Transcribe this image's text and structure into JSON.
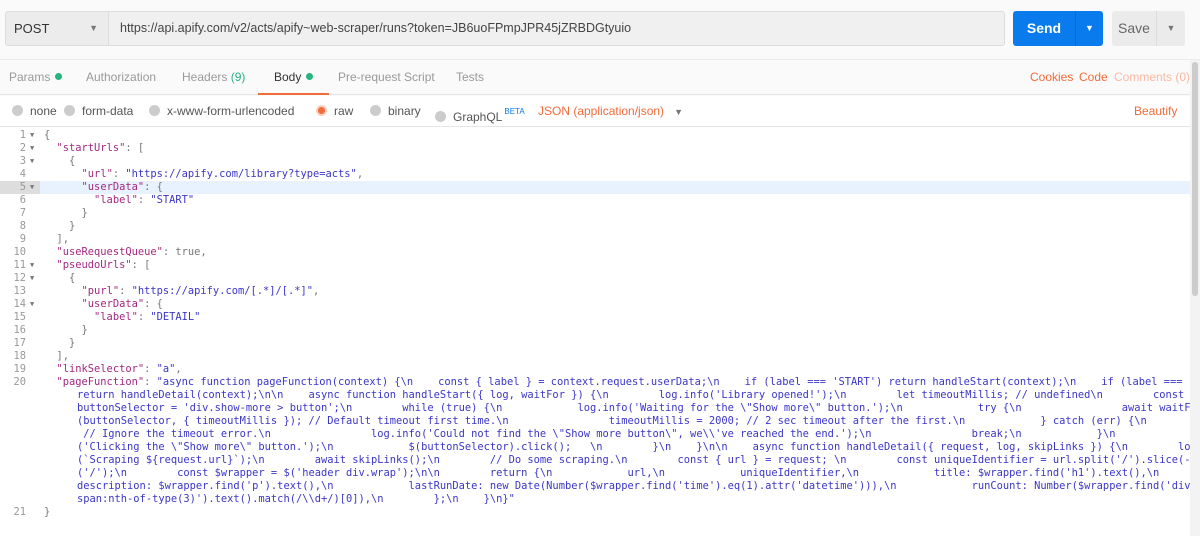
{
  "request": {
    "method": "POST",
    "url": "https://api.apify.com/v2/acts/apify~web-scraper/runs?token=JB6uoFPmpJPR45jZRBDGtyuio",
    "send_label": "Send",
    "save_label": "Save"
  },
  "tabs": [
    {
      "label": "Params",
      "dot": true
    },
    {
      "label": "Authorization"
    },
    {
      "label": "Headers",
      "count": "(9)"
    },
    {
      "label": "Body",
      "dot": true,
      "active": true
    },
    {
      "label": "Pre-request Script"
    },
    {
      "label": "Tests"
    }
  ],
  "links": {
    "cookies": "Cookies",
    "code": "Code",
    "comments": "Comments (0)"
  },
  "body_types": [
    {
      "label": "none"
    },
    {
      "label": "form-data"
    },
    {
      "label": "x-www-form-urlencoded"
    },
    {
      "label": "raw",
      "selected": true
    },
    {
      "label": "binary"
    },
    {
      "label": "GraphQL",
      "badge": "BETA"
    }
  ],
  "content_type": "JSON (application/json)",
  "beautify": "Beautify",
  "colors": {
    "accent": "#f26b3a",
    "send": "#097bed",
    "key": "#a3287f",
    "string": "#3b36c7"
  },
  "editor": {
    "lines": [
      {
        "n": "1",
        "fold": true,
        "parts": [
          [
            "p",
            "{"
          ]
        ]
      },
      {
        "n": "2",
        "fold": true,
        "parts": [
          [
            "p",
            "  "
          ],
          [
            "k",
            "\"startUrls\""
          ],
          [
            "p",
            ": ["
          ]
        ]
      },
      {
        "n": "3",
        "fold": true,
        "parts": [
          [
            "p",
            "    {"
          ]
        ]
      },
      {
        "n": "4",
        "parts": [
          [
            "p",
            "      "
          ],
          [
            "k",
            "\"url\""
          ],
          [
            "p",
            ": "
          ],
          [
            "s",
            "\"https://apify.com/library?type=acts\""
          ],
          [
            "p",
            ","
          ]
        ]
      },
      {
        "n": "5",
        "fold": true,
        "hl": true,
        "parts": [
          [
            "p",
            "      "
          ],
          [
            "k",
            "\"userData\""
          ],
          [
            "p",
            ": {"
          ]
        ]
      },
      {
        "n": "6",
        "parts": [
          [
            "p",
            "        "
          ],
          [
            "k",
            "\"label\""
          ],
          [
            "p",
            ": "
          ],
          [
            "s",
            "\"START\""
          ]
        ]
      },
      {
        "n": "7",
        "parts": [
          [
            "p",
            "      }"
          ]
        ]
      },
      {
        "n": "8",
        "parts": [
          [
            "p",
            "    }"
          ]
        ]
      },
      {
        "n": "9",
        "parts": [
          [
            "p",
            "  ],"
          ]
        ]
      },
      {
        "n": "10",
        "parts": [
          [
            "p",
            "  "
          ],
          [
            "k",
            "\"useRequestQueue\""
          ],
          [
            "p",
            ": true,"
          ]
        ]
      },
      {
        "n": "11",
        "fold": true,
        "parts": [
          [
            "p",
            "  "
          ],
          [
            "k",
            "\"pseudoUrls\""
          ],
          [
            "p",
            ": ["
          ]
        ]
      },
      {
        "n": "12",
        "fold": true,
        "parts": [
          [
            "p",
            "    {"
          ]
        ]
      },
      {
        "n": "13",
        "parts": [
          [
            "p",
            "      "
          ],
          [
            "k",
            "\"purl\""
          ],
          [
            "p",
            ": "
          ],
          [
            "s",
            "\"https://apify.com/[.*]/[.*]\""
          ],
          [
            "p",
            ","
          ]
        ]
      },
      {
        "n": "14",
        "fold": true,
        "parts": [
          [
            "p",
            "      "
          ],
          [
            "k",
            "\"userData\""
          ],
          [
            "p",
            ": {"
          ]
        ]
      },
      {
        "n": "15",
        "parts": [
          [
            "p",
            "        "
          ],
          [
            "k",
            "\"label\""
          ],
          [
            "p",
            ": "
          ],
          [
            "s",
            "\"DETAIL\""
          ]
        ]
      },
      {
        "n": "16",
        "parts": [
          [
            "p",
            "      }"
          ]
        ]
      },
      {
        "n": "17",
        "parts": [
          [
            "p",
            "    }"
          ]
        ]
      },
      {
        "n": "18",
        "parts": [
          [
            "p",
            "  ],"
          ]
        ]
      },
      {
        "n": "19",
        "parts": [
          [
            "p",
            "  "
          ],
          [
            "k",
            "\"linkSelector\""
          ],
          [
            "p",
            ": "
          ],
          [
            "s",
            "\"a\""
          ],
          [
            "p",
            ","
          ]
        ]
      },
      {
        "n": "20",
        "parts": [
          [
            "p",
            "  "
          ],
          [
            "k",
            "\"pageFunction\""
          ],
          [
            "p",
            ": "
          ],
          [
            "s",
            "\"async function pageFunction(context) {\\n    const { label } = context.request.userData;\\n    if (label === 'START') return handleStart(context);\\n    if (label === 'DETAIL')"
          ]
        ],
        "wrapped": [
          "return handleDetail(context);\\n\\n    async function handleStart({ log, waitFor }) {\\n        log.info('Library opened!');\\n        let timeoutMillis; // undefined\\n        const",
          "buttonSelector = 'div.show-more > button';\\n        while (true) {\\n            log.info('Waiting for the \\\"Show more\\\" button.');\\n            try {\\n                await waitFor",
          "(buttonSelector, { timeoutMillis }); // Default timeout first time.\\n                timeoutMillis = 2000; // 2 sec timeout after the first.\\n            } catch (err) {\\n",
          " // Ignore the timeout error.\\n                log.info('Could not find the \\\"Show more button\\\", we\\\\'ve reached the end.');\\n                break;\\n            }\\n            log.info",
          "('Clicking the \\\"Show more\\\" button.');\\n            $(buttonSelector).click();   \\n        }\\n    }\\n\\n    async function handleDetail({ request, log, skipLinks }) {\\n        log.info",
          "(`Scraping ${request.url}`);\\n        await skipLinks();\\n        // Do some scraping.\\n        const { url } = request; \\n        const uniqueIdentifier = url.split('/').slice(-2).join",
          "('/');\\n        const $wrapper = $('header div.wrap');\\n\\n        return {\\n            url,\\n            uniqueIdentifier,\\n            title: $wrapper.find('h1').text(),\\n",
          "description: $wrapper.find('p').text(),\\n            lastRunDate: new Date(Number($wrapper.find('time').eq(1).attr('datetime'))),\\n            runCount: Number($wrapper.find('div.stats >",
          "span:nth-of-type(3)').text().match(/\\\\d+/)[0]),\\n        };\\n    }\\n}\""
        ]
      },
      {
        "n": "21",
        "parts": [
          [
            "p",
            "}"
          ]
        ]
      }
    ]
  }
}
